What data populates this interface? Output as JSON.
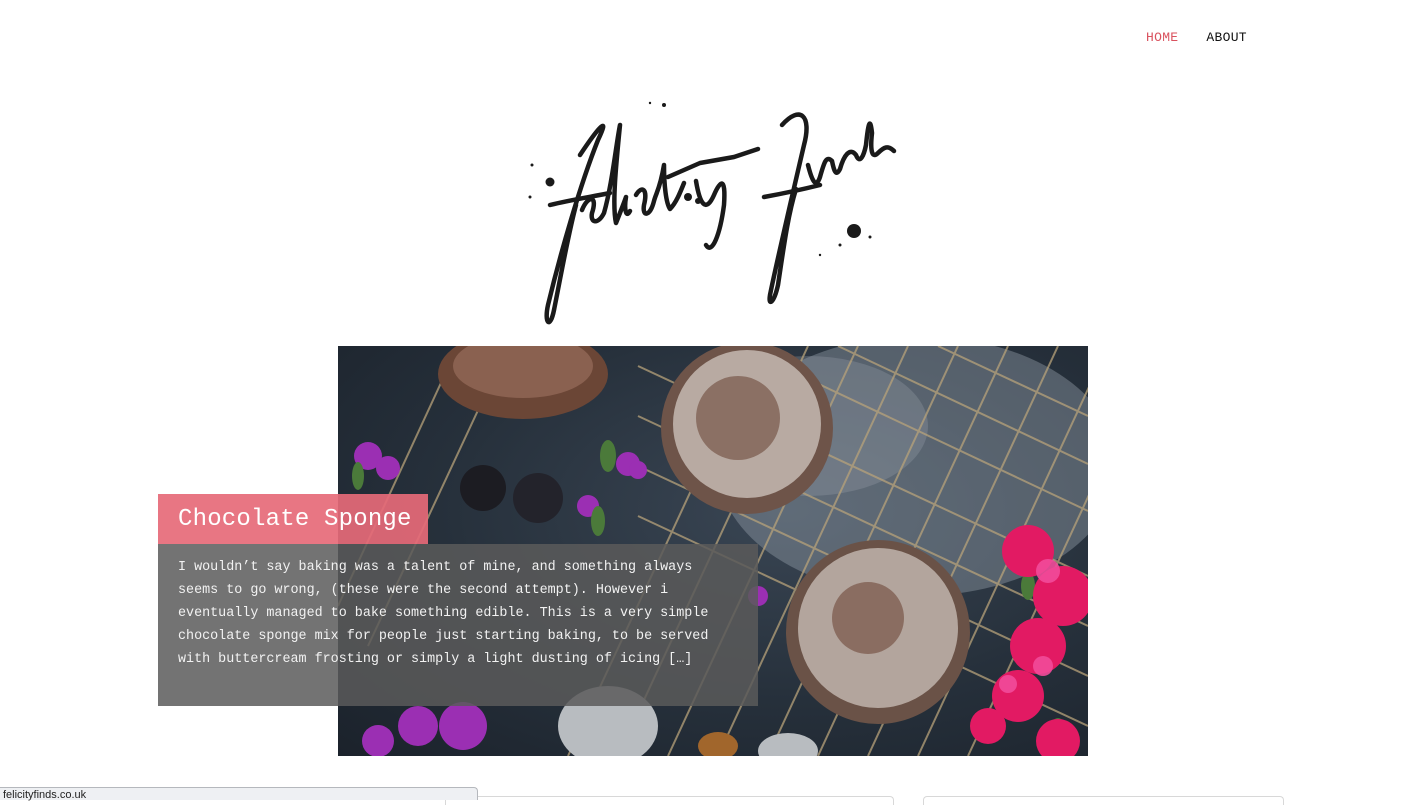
{
  "nav": {
    "items": [
      {
        "label": "HOME",
        "active": true
      },
      {
        "label": "ABOUT",
        "active": false
      }
    ],
    "active_color": "#d9525e"
  },
  "logo": {
    "alt": "felicity finds"
  },
  "featured_post": {
    "title": "Chocolate Sponge",
    "excerpt": "I wouldn’t say baking was a talent of mine, and something always seems to go wrong, (these were the second attempt). However i eventually managed to bake something edible.  This is a very simple chocolate sponge mix for people just starting baking, to be served with buttercream frosting or simply a light dusting of icing […]",
    "title_bg_color": "#e66a78",
    "excerpt_bg_color": "#5a5a5a"
  },
  "status_bar": {
    "url": "felicityfinds.co.uk"
  }
}
